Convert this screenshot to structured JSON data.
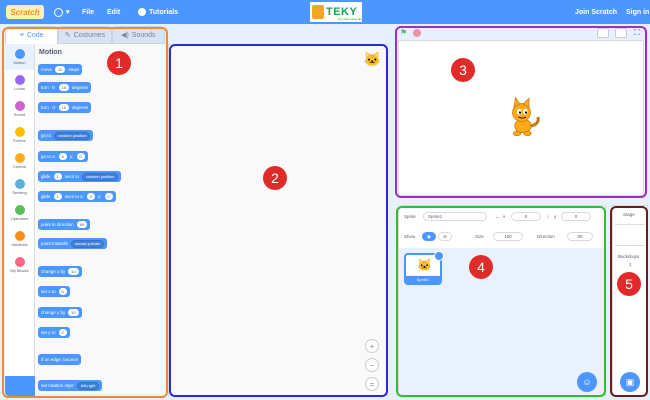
{
  "menubar": {
    "logo": "Scratch",
    "file": "File",
    "edit": "Edit",
    "tutorials": "Tutorials",
    "join": "Join Scratch",
    "signin": "Sign in",
    "brand": "TEKY",
    "brand_sub": "Học viện sáng tạo"
  },
  "tabs": [
    "Code",
    "Costumes",
    "Sounds"
  ],
  "categories": [
    {
      "label": "Motion",
      "color": "#4c97ff"
    },
    {
      "label": "Looks",
      "color": "#9966ff"
    },
    {
      "label": "Sound",
      "color": "#cf63cf"
    },
    {
      "label": "Events",
      "color": "#ffbf00"
    },
    {
      "label": "Control",
      "color": "#ffab19"
    },
    {
      "label": "Sensing",
      "color": "#5cb1d6"
    },
    {
      "label": "Operators",
      "color": "#59c059"
    },
    {
      "label": "Variables",
      "color": "#ff8c1a"
    },
    {
      "label": "My Blocks",
      "color": "#ff6680"
    }
  ],
  "palette": {
    "title": "Motion",
    "blocks": {
      "move": "move",
      "move_val": "10",
      "move_unit": "steps",
      "turn_r": "turn",
      "turn_r_val": "15",
      "turn_r_unit": "degrees",
      "turn_l": "turn",
      "turn_l_val": "15",
      "turn_l_unit": "degrees",
      "goto": "go to",
      "goto_dd": "random position",
      "gotoxy": "go to x:",
      "gotoxy_x": "0",
      "gotoxy_y_lbl": "y:",
      "gotoxy_y": "0",
      "glide": "glide",
      "glide_val": "1",
      "glide_mid": "secs to",
      "glide_dd": "random position",
      "glidexy": "glide",
      "glidexy_val": "1",
      "glidexy_mid": "secs to x:",
      "glidexy_x": "0",
      "glidexy_ylbl": "y:",
      "glidexy_y": "0",
      "point": "point in direction",
      "point_val": "90",
      "towards": "point towards",
      "towards_dd": "mouse-pointer",
      "changex": "change x by",
      "changex_val": "10",
      "setx": "set x to",
      "setx_val": "0",
      "changey": "change y by",
      "changey_val": "10",
      "sety": "set y to",
      "sety_val": "0",
      "bounce": "if on edge, bounce",
      "rotstyle": "set rotation style",
      "rotstyle_dd": "left-right"
    }
  },
  "sprite_info": {
    "sprite_lbl": "Sprite",
    "sprite_name": "Sprite1",
    "x_lbl": "x",
    "x": "0",
    "y_lbl": "y",
    "y": "0",
    "show_lbl": "Show",
    "size_lbl": "Size",
    "size": "100",
    "dir_lbl": "Direction",
    "dir": "90",
    "card_name": "Sprite1"
  },
  "stage_col": {
    "title": "Stage",
    "backdrops_lbl": "Backdrops",
    "backdrops": "1"
  },
  "badges": [
    "1",
    "2",
    "3",
    "4",
    "5"
  ],
  "colors": {
    "primary": "#4c97ff",
    "box1": "#f08a30",
    "box2": "#2a2ad8",
    "box3": "#9b30c8",
    "box4": "#2ec02e",
    "box5": "#6b1d1d",
    "badge": "#e02b2b"
  }
}
